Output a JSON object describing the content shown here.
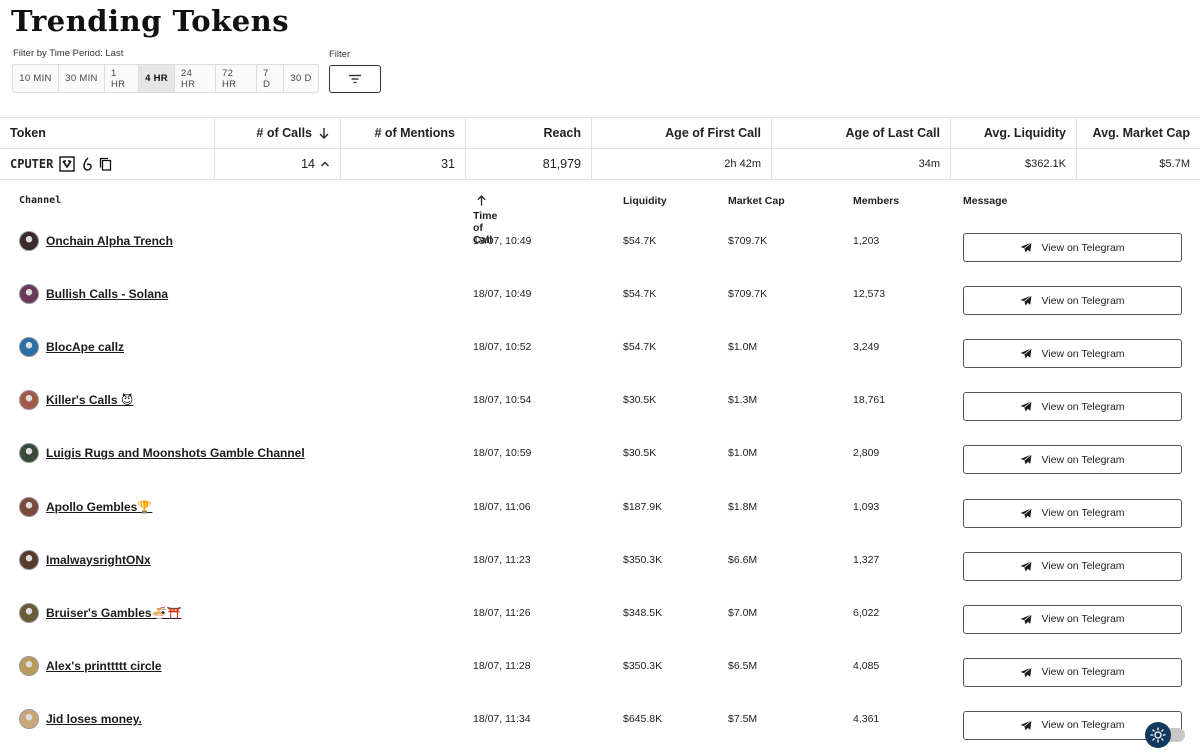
{
  "page": {
    "title": "Trending Tokens"
  },
  "filters": {
    "time_label": "Filter by Time Period: Last",
    "filter_label": "Filter",
    "periods": [
      "10 MIN",
      "30 MIN",
      "1 HR",
      "4 HR",
      "24 HR",
      "72 HR",
      "7 D",
      "30 D"
    ],
    "active_period": "4 HR"
  },
  "token_table": {
    "headers": {
      "token": "Token",
      "calls": "# of Calls",
      "mentions": "# of Mentions",
      "reach": "Reach",
      "first_call": "Age of First Call",
      "last_call": "Age of Last Call",
      "liquidity": "Avg. Liquidity",
      "market_cap": "Avg. Market Cap"
    },
    "row": {
      "ticker": "CPUTER",
      "calls": "14",
      "mentions": "31",
      "reach": "81,979",
      "first_call": "2h 42m",
      "last_call": "34m",
      "liquidity": "$362.1K",
      "market_cap": "$5.7M"
    }
  },
  "calls_table": {
    "headers": {
      "channel": "Channel",
      "time": "Time of Call",
      "liquidity": "Liquidity",
      "market_cap": "Market Cap",
      "members": "Members",
      "message": "Message"
    },
    "button_label": "View on Telegram",
    "rows": [
      {
        "channel": "Onchain Alpha Trench",
        "time": "18/07, 10:49",
        "liquidity": "$54.7K",
        "market_cap": "$709.7K",
        "members": "1,203",
        "avatar_color": "#3a2a2a"
      },
      {
        "channel": "Bullish Calls - Solana",
        "time": "18/07, 10:49",
        "liquidity": "$54.7K",
        "market_cap": "$709.7K",
        "members": "12,573",
        "avatar_color": "#6b3a5a"
      },
      {
        "channel": "BlocApe callz",
        "time": "18/07, 10:52",
        "liquidity": "$54.7K",
        "market_cap": "$1.0M",
        "members": "3,249",
        "avatar_color": "#2a6fa8"
      },
      {
        "channel": "Killer's Calls 😈",
        "time": "18/07, 10:54",
        "liquidity": "$30.5K",
        "market_cap": "$1.3M",
        "members": "18,761",
        "avatar_color": "#a05a4a"
      },
      {
        "channel": "Luigis Rugs and Moonshots Gamble Channel",
        "time": "18/07, 10:59",
        "liquidity": "$30.5K",
        "market_cap": "$1.0M",
        "members": "2,809",
        "avatar_color": "#3a4a3a"
      },
      {
        "channel": "Apollo Gembles🏆",
        "time": "18/07, 11:06",
        "liquidity": "$187.9K",
        "market_cap": "$1.8M",
        "members": "1,093",
        "avatar_color": "#7a4a3a"
      },
      {
        "channel": "ImalwaysrightONx",
        "time": "18/07, 11:23",
        "liquidity": "$350.3K",
        "market_cap": "$6.6M",
        "members": "1,327",
        "avatar_color": "#5a3a2a"
      },
      {
        "channel": "Bruiser's Gambles🍜⛩️",
        "time": "18/07, 11:26",
        "liquidity": "$348.5K",
        "market_cap": "$7.0M",
        "members": "6,022",
        "avatar_color": "#6a5a3a"
      },
      {
        "channel": "Alex's printtttt circle",
        "time": "18/07, 11:28",
        "liquidity": "$350.3K",
        "market_cap": "$6.5M",
        "members": "4,085",
        "avatar_color": "#b89a5a"
      },
      {
        "channel": "Jid loses money.",
        "time": "18/07, 11:34",
        "liquidity": "$645.8K",
        "market_cap": "$7.5M",
        "members": "4,361",
        "avatar_color": "#c8a878"
      }
    ]
  },
  "icons": {
    "sort_down": "arrow-down-icon",
    "sort_up": "arrow-up-icon",
    "expand": "chevron-up-icon",
    "filter": "filter-lines-icon",
    "telegram": "telegram-icon",
    "copy": "copy-icon",
    "theme": "sun-icon"
  },
  "colors": {
    "theme_knob": "#123a5e",
    "active_period_bg": "#e6e6e6"
  }
}
